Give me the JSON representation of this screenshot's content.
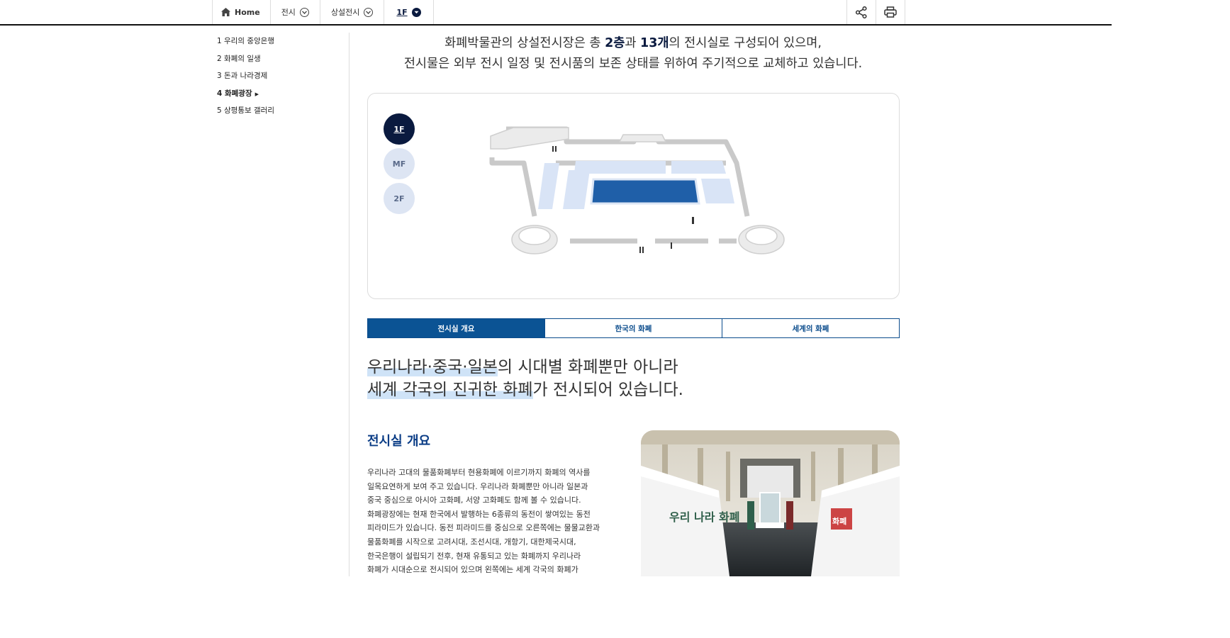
{
  "nav": {
    "home": "Home",
    "crumbs": [
      "전시",
      "상설전시",
      "1F"
    ]
  },
  "sidebar": {
    "items": [
      {
        "label": "1 우리의 중앙은행"
      },
      {
        "label": "2 화폐의 일생"
      },
      {
        "label": "3 돈과 나라경제"
      },
      {
        "label": "4 화폐광장"
      },
      {
        "label": "5 상평통보 갤러리"
      }
    ]
  },
  "intro": {
    "line1_a": "화폐박물관의 상설전시장은 총 ",
    "line1_b": "2층",
    "line1_c": "과 ",
    "line1_d": "13개",
    "line1_e": "의 전시실로 구성되어 있으며,",
    "line2": "전시물은 외부 전시 일정 및 전시품의 보존 상태를 위하여 주기적으로 교체하고 있습니다."
  },
  "floors": [
    {
      "label": "1F",
      "active": true
    },
    {
      "label": "MF",
      "active": false
    },
    {
      "label": "2F",
      "active": false
    }
  ],
  "tabs": [
    {
      "label": "전시실 개요",
      "active": true
    },
    {
      "label": "한국의 화폐",
      "active": false
    },
    {
      "label": "세계의 화폐",
      "active": false
    }
  ],
  "headline": {
    "line1_hl": "우리나라·중국·일본",
    "line1_rest": "의 시대별 화폐뿐만 아니라",
    "line2_hl": "세계 각국의 진귀한 화폐",
    "line2_rest": "가 전시되어 있습니다."
  },
  "section": {
    "title": "전시실 개요",
    "lines": [
      "우리나라 고대의 물품화폐부터 현용화폐에 이르기까지 화폐의 역사를",
      "일목요연하게 보여 주고 있습니다. 우리나라 화폐뿐만 아니라 일본과",
      "중국 중심으로 아시아 고화폐, 서양 고화폐도 함께 볼 수 있습니다.",
      "화폐광장에는 현재 한국에서 발행하는 6종류의 동전이 쌓여있는 동전",
      "피라미드가 있습니다. 동전 피라미드를 중심으로 오른쪽에는 물물교환과",
      "물품화폐를 시작으로 고려시대, 조선시대, 개항기, 대한제국시대,",
      "한국은행이 설립되기 전후, 현재 유통되고 있는 화폐까지 우리나라",
      "화폐가 시대순으로 전시되어 있으며 왼쪽에는 세계 각국의 화폐가"
    ]
  },
  "photo": {
    "sign_left": "우리 나라 화폐",
    "sign_right": "화폐"
  },
  "colors": {
    "navy": "#0a1a3f",
    "tab_blue": "#0b5394",
    "map_highlight": "#1f5fa8",
    "map_room": "#d9e4f6"
  }
}
